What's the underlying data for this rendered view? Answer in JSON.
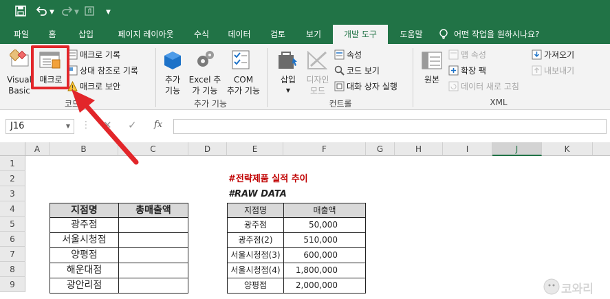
{
  "titlebar": {
    "icons": [
      "save-icon",
      "undo-icon",
      "redo-icon",
      "touch-mode-icon",
      "customize-qat-icon"
    ]
  },
  "tabs": [
    {
      "label": "파일"
    },
    {
      "label": "홈"
    },
    {
      "label": "삽입"
    },
    {
      "label": "페이지 레이아웃"
    },
    {
      "label": "수식"
    },
    {
      "label": "데이터"
    },
    {
      "label": "검토"
    },
    {
      "label": "보기"
    },
    {
      "label": "개발 도구",
      "active": true
    },
    {
      "label": "도움말"
    }
  ],
  "tell_me": "어떤 작업을 원하시나요?",
  "ribbon": {
    "code": {
      "visual_basic_line1": "Visual",
      "visual_basic_line2": "Basic",
      "macro": "매크로",
      "record_macro": "매크로 기록",
      "relative_refs": "상대 참조로 기록",
      "macro_security": "매크로 보안",
      "group_label": "코드"
    },
    "addins": {
      "addins_line1": "추가",
      "addins_line2": "기능",
      "excel_addins_line1": "Excel 추",
      "excel_addins_line2": "가 기능",
      "com_addins_line1": "COM",
      "com_addins_line2": "추가 기능",
      "group_label": "추가 기능"
    },
    "controls": {
      "insert": "삽입",
      "design_mode_line1": "디자인",
      "design_mode_line2": "모드",
      "properties": "속성",
      "view_code": "코드 보기",
      "run_dialog": "대화 상자 실행",
      "group_label": "컨트롤"
    },
    "xml": {
      "source": "원본",
      "map_properties": "맵 속성",
      "expansion_packs": "확장 팩",
      "refresh_data": "데이터 새로 고침",
      "import": "가져오기",
      "export": "내보내기",
      "group_label": "XML"
    }
  },
  "formula_bar": {
    "name_box": "J16",
    "fx": "fx",
    "formula": ""
  },
  "columns": [
    "A",
    "B",
    "C",
    "D",
    "E",
    "F",
    "G",
    "H",
    "I",
    "J",
    "K"
  ],
  "selected_column": "J",
  "rows": [
    "1",
    "2",
    "3",
    "4",
    "5",
    "6",
    "7",
    "8",
    "9"
  ],
  "sheet": {
    "title": "#전략제품 실적 추이",
    "subtitle": "#RAW DATA",
    "summary_headers": [
      "지점명",
      "총매출액"
    ],
    "summary_rows": [
      "광주점",
      "서울시청점",
      "양평점",
      "해운대점",
      "광안리점"
    ],
    "raw_headers": [
      "지점명",
      "매출액"
    ],
    "raw_rows": [
      {
        "name": "광주점",
        "amount": "50,000"
      },
      {
        "name": "광주점(2)",
        "amount": "510,000"
      },
      {
        "name": "서울시청점(3)",
        "amount": "600,000"
      },
      {
        "name": "서울시청점(4)",
        "amount": "1,800,000"
      },
      {
        "name": "양평점",
        "amount": "2,000,000"
      }
    ]
  },
  "watermark": "코와리",
  "colors": {
    "excel_green": "#217346",
    "highlight_red": "#e2262a",
    "title_red": "#c00000"
  }
}
